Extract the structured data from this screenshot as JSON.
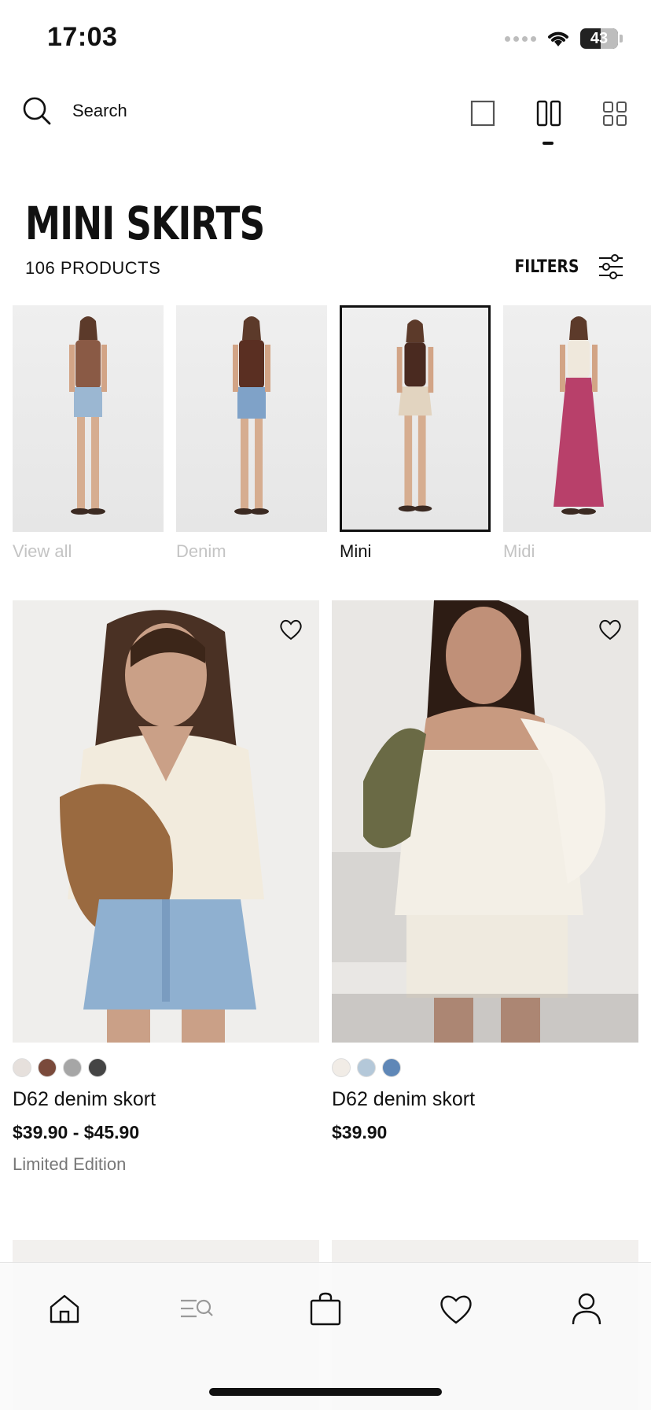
{
  "status": {
    "time": "17:03",
    "battery": "43"
  },
  "header": {
    "search_label": "Search",
    "view_modes": [
      "single-view-icon",
      "two-column-view-icon",
      "grid-view-icon"
    ]
  },
  "page": {
    "title": "MINI SKIRTS",
    "count": "106 PRODUCTS",
    "filters_label": "FILTERS"
  },
  "categories": [
    {
      "label": "View all",
      "selected": false
    },
    {
      "label": "Denim",
      "selected": false
    },
    {
      "label": "Mini",
      "selected": true
    },
    {
      "label": "Midi",
      "selected": false
    }
  ],
  "products": [
    {
      "name": "D62 denim skort",
      "price": "$39.90 - $45.90",
      "note": "Limited Edition",
      "swatches": [
        "#e6e0dc",
        "#7a4a3b",
        "#a6a6a6",
        "#454545"
      ]
    },
    {
      "name": "D62 denim skort",
      "price": "$39.90",
      "note": "",
      "swatches": [
        "#f1ece6",
        "#b4c8d9",
        "#5f87b7"
      ]
    }
  ],
  "nav": [
    "home-icon",
    "search-menu-icon",
    "bag-icon",
    "wishlist-icon",
    "account-icon"
  ]
}
